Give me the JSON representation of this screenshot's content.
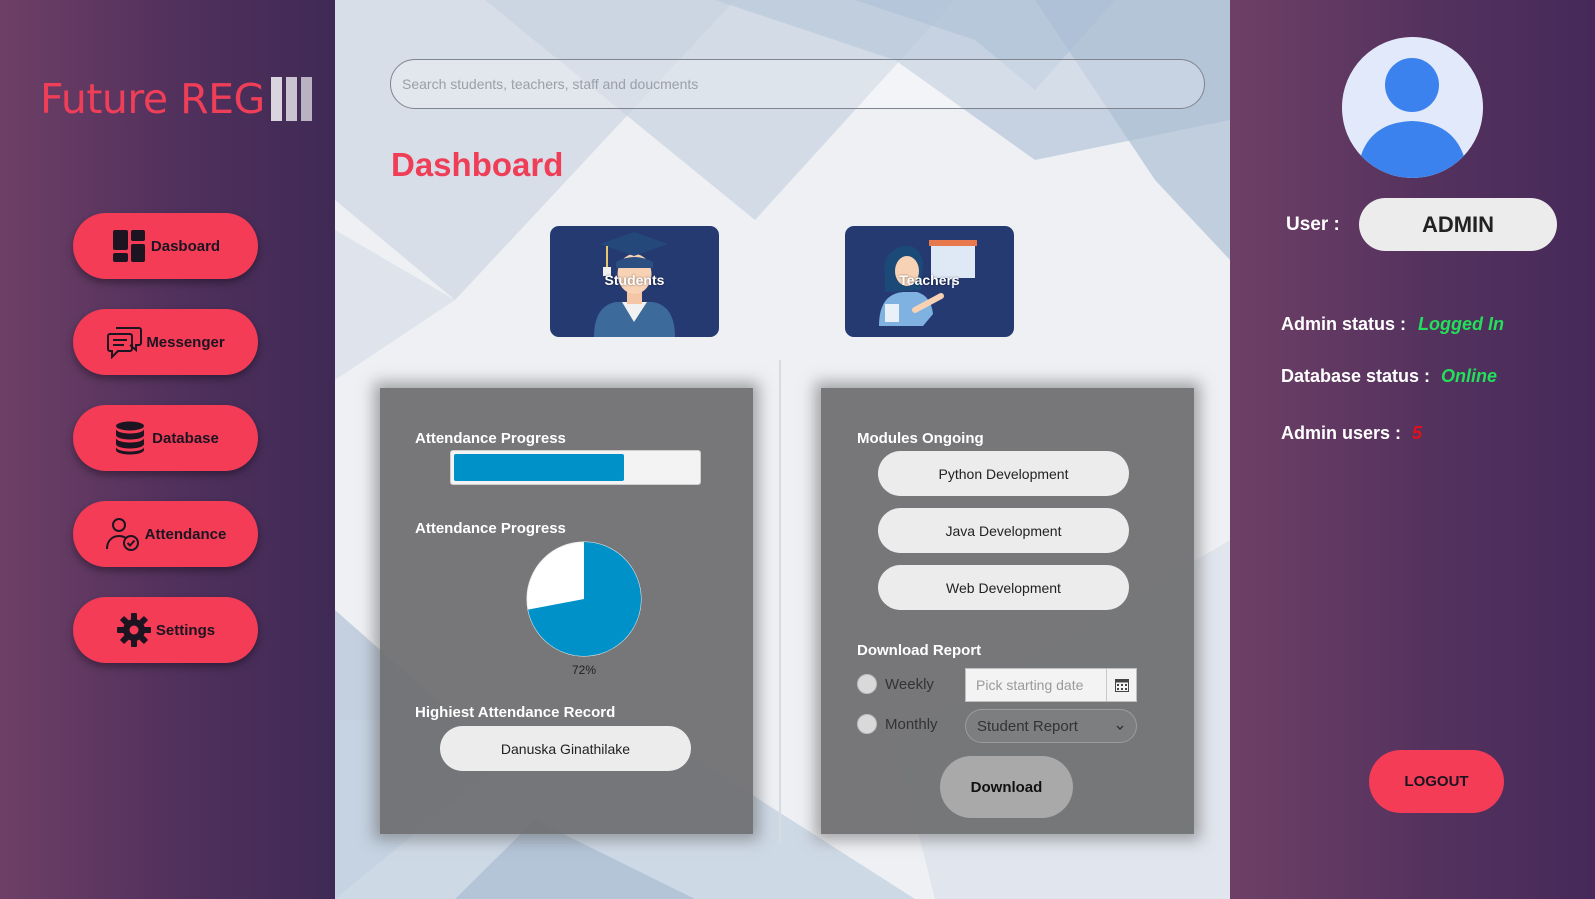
{
  "app": {
    "logo_text": "Future REG"
  },
  "sidebar": {
    "items": [
      {
        "label": "Dasboard",
        "icon": "dashboard-icon"
      },
      {
        "label": "Messenger",
        "icon": "chat-icon"
      },
      {
        "label": "Database",
        "icon": "database-icon"
      },
      {
        "label": "Attendance",
        "icon": "user-check-icon"
      },
      {
        "label": "Settings",
        "icon": "gear-icon"
      }
    ]
  },
  "search": {
    "placeholder": "Search students, teachers, staff and doucments"
  },
  "main": {
    "title": "Dashboard",
    "tiles": [
      {
        "label": "Students",
        "icon": "graduate-icon"
      },
      {
        "label": "Teachers",
        "icon": "teacher-icon"
      }
    ],
    "left_card": {
      "progress_heading": "Attendance Progress",
      "progress_value": 0.7,
      "pie_heading": "Attendance Progress",
      "pie_value": 72,
      "pie_label": "72%",
      "record_heading": "Highiest Attendance Record",
      "record_value": "Danuska Ginathilake"
    },
    "right_card": {
      "modules_heading": "Modules Ongoing",
      "modules": [
        "Python Development",
        "Java Development",
        "Web Development"
      ],
      "report_heading": "Download Report",
      "weekly_label": "Weekly",
      "monthly_label": "Monthly",
      "date_placeholder": "Pick starting date",
      "report_select": "Student Report",
      "download_label": "Download"
    }
  },
  "user_panel": {
    "user_label": "User :",
    "user_name": "ADMIN",
    "admin_status_label": "Admin status :",
    "admin_status_value": "Logged In",
    "db_status_label": "Database status :",
    "db_status_value": "Online",
    "admin_users_label": "Admin users :",
    "admin_users_value": "5",
    "logout_label": "LOGOUT"
  },
  "colors": {
    "accent": "#f43c57",
    "status_green": "#22e05a",
    "status_red": "#e0101a",
    "progress_blue": "#0191c9",
    "tile_navy": "#263a72"
  }
}
